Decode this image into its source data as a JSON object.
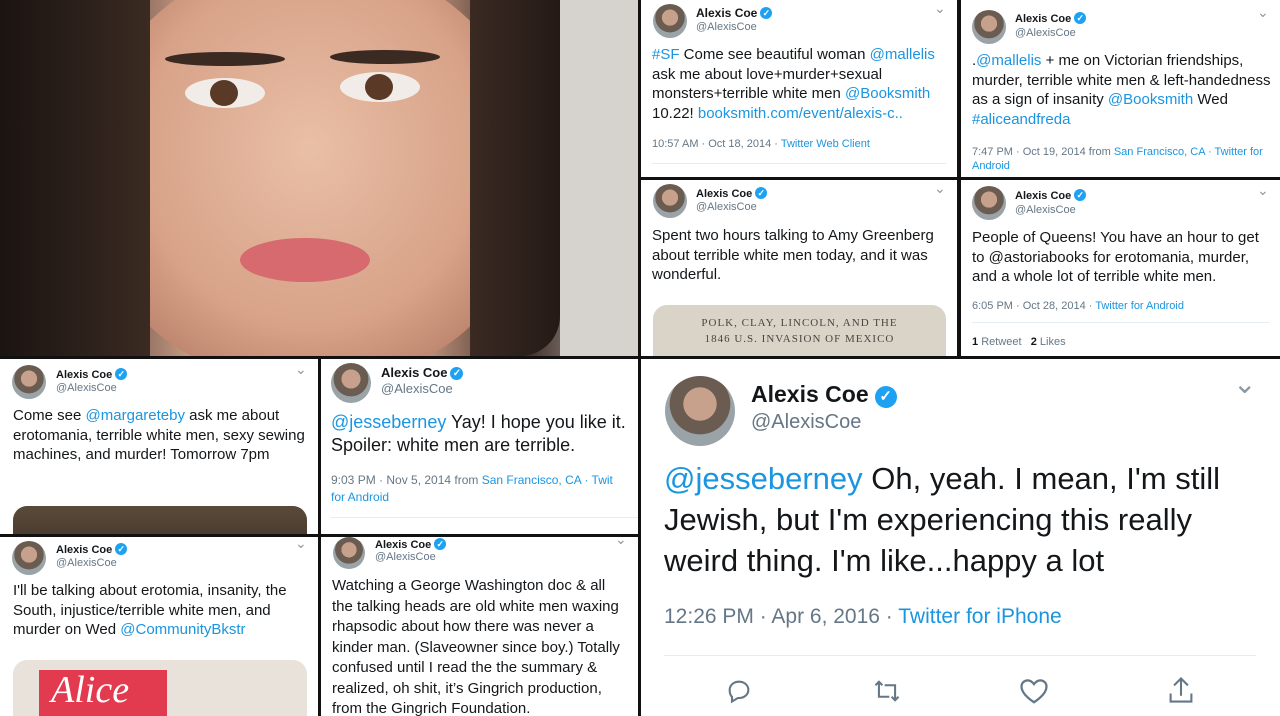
{
  "author": {
    "name": "Alexis Coe",
    "handle": "@AlexisCoe",
    "verified_mark": "✓",
    "chevron": "⌄"
  },
  "tweet1": {
    "parts": [
      {
        "t": "#SF",
        "link": true
      },
      {
        "t": " Come see beautiful woman ",
        "link": false
      },
      {
        "t": "@mallelis",
        "link": true
      },
      {
        "t": " ask me about love+murder+sexual monsters+terrible white men ",
        "link": false
      },
      {
        "t": "@Booksmith",
        "link": true
      },
      {
        "t": " 10.22! ",
        "link": false
      },
      {
        "t": "booksmith.com/event/alexis-c..",
        "link": true
      }
    ],
    "meta": "10:57 AM · Oct 18, 2014 · ",
    "source": "Twitter Web Client"
  },
  "tweet2": {
    "parts": [
      {
        "t": ".",
        "link": false
      },
      {
        "t": "@mallelis",
        "link": true
      },
      {
        "t": " + me on Victorian friendships, murder, terrible white men & left-handedness as a sign of insanity ",
        "link": false
      },
      {
        "t": "@Booksmith",
        "link": true
      },
      {
        "t": " Wed ",
        "link": false
      },
      {
        "t": "#aliceandfreda",
        "link": true
      }
    ],
    "meta": "7:47 PM · Oct 19, 2014 from ",
    "location": "San Francisco, CA",
    "source": " · Twitter for Android"
  },
  "tweet3": {
    "text": "Spent two hours talking to Amy Greenberg about terrible white men today, and it was wonderful.",
    "book_line1": "POLK, CLAY, LINCOLN, AND THE",
    "book_line2": "1846 U.S. INVASION OF MEXICO"
  },
  "tweet4": {
    "text": "People of Queens! You have an hour to get to @astoriabooks for erotomania, murder, and a whole lot of terrible white men.",
    "meta": "6:05 PM · Oct 28, 2014 · ",
    "source": "Twitter for Android",
    "retweets_count": "1",
    "retweets_label": "Retweet",
    "likes_count": "2",
    "likes_label": "Likes"
  },
  "tweet5": {
    "parts": [
      {
        "t": "Come see ",
        "link": false
      },
      {
        "t": "@margareteby",
        "link": true
      },
      {
        "t": " ask me about erotomania, terrible white men, sexy sewing machines, and murder! Tomorrow 7pm",
        "link": false
      }
    ]
  },
  "tweet6": {
    "parts": [
      {
        "t": "@jesseberney",
        "link": true
      },
      {
        "t": " Yay! I hope you like it. Spoiler: white men are terrible.",
        "link": false
      }
    ],
    "meta": "9:03 PM · Nov 5, 2014 from ",
    "location": "San Francisco, CA",
    "source": " · Twit",
    "source2": "for Android"
  },
  "tweet7": {
    "parts": [
      {
        "t": "I'll be talking about erotomia, insanity, the South, injustice/terrible white men, and murder on Wed ",
        "link": false
      },
      {
        "t": "@CommunityBkstr",
        "link": true
      }
    ],
    "poster_text": "Alice"
  },
  "tweet8": {
    "text": "Watching a George Washington doc & all the talking heads are old white men waxing rhapsodic about how there was never a kinder man. (Slaveowner since boy.) Totally confused until I read the the summary & realized, oh shit, it’s Gingrich production, from the Gingrich Foundation."
  },
  "tweet9": {
    "parts": [
      {
        "t": "@jesseberney",
        "link": true
      },
      {
        "t": " Oh, yeah. I mean, I'm still Jewish, but I'm experiencing this really weird thing. I'm like...happy a lot",
        "link": false
      }
    ],
    "meta": "12:26 PM · Apr 6, 2016 · ",
    "source": "Twitter for iPhone"
  }
}
